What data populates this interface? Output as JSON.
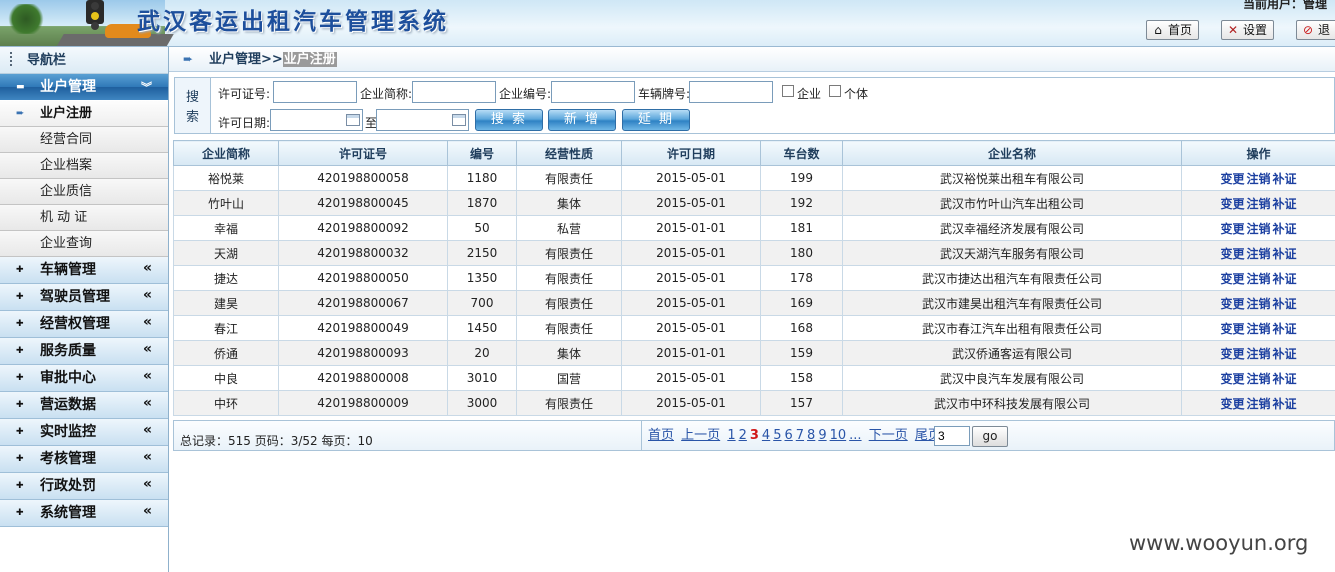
{
  "header": {
    "title": "武汉客运出租汽车管理系统",
    "current_user": "当前用户：管理",
    "buttons": [
      {
        "label": "首页",
        "icon": "home-icon"
      },
      {
        "label": "设置",
        "icon": "tools-icon"
      },
      {
        "label": "退",
        "icon": "stop-icon"
      }
    ]
  },
  "sidebar": {
    "title": "导航栏",
    "active_group": {
      "label": "业户管理",
      "items": [
        {
          "label": "业户注册",
          "active": true
        },
        {
          "label": "经营合同"
        },
        {
          "label": "企业档案"
        },
        {
          "label": "企业质信"
        },
        {
          "label": "机 动 证"
        },
        {
          "label": "企业查询"
        }
      ]
    },
    "groups": [
      "车辆管理",
      "驾驶员管理",
      "经营权管理",
      "服务质量",
      "审批中心",
      "营运数据",
      "实时监控",
      "考核管理",
      "行政处罚",
      "系统管理"
    ]
  },
  "breadcrumb": {
    "parent": "业户管理>>",
    "current": "业户注册"
  },
  "search": {
    "label": "搜索",
    "fields": {
      "license_no": "许可证号:",
      "company_abbr": "企业简称:",
      "company_no": "企业编号:",
      "plate_no": "车辆牌号:",
      "enterprise": "企业",
      "individual": "个体",
      "license_date": "许可日期:",
      "to": "至"
    },
    "buttons": {
      "search": "搜 索",
      "add": "新 增",
      "extend": "延 期"
    }
  },
  "table": {
    "columns": [
      "企业简称",
      "许可证号",
      "编号",
      "经营性质",
      "许可日期",
      "车台数",
      "企业名称",
      "操作"
    ],
    "actions": [
      "变更",
      "注销",
      "补证"
    ],
    "rows": [
      [
        "裕悦莱",
        "420198800058",
        "1180",
        "有限责任",
        "2015-05-01",
        "199",
        "武汉裕悦莱出租车有限公司"
      ],
      [
        "竹叶山",
        "420198800045",
        "1870",
        "集体",
        "2015-05-01",
        "192",
        "武汉市竹叶山汽车出租公司"
      ],
      [
        "幸福",
        "420198800092",
        "50",
        "私营",
        "2015-01-01",
        "181",
        "武汉幸福经济发展有限公司"
      ],
      [
        "天湖",
        "420198800032",
        "2150",
        "有限责任",
        "2015-05-01",
        "180",
        "武汉天湖汽车服务有限公司"
      ],
      [
        "捷达",
        "420198800050",
        "1350",
        "有限责任",
        "2015-05-01",
        "178",
        "武汉市捷达出租汽车有限责任公司"
      ],
      [
        "建昊",
        "420198800067",
        "700",
        "有限责任",
        "2015-05-01",
        "169",
        "武汉市建昊出租汽车有限责任公司"
      ],
      [
        "春江",
        "420198800049",
        "1450",
        "有限责任",
        "2015-05-01",
        "168",
        "武汉市春江汽车出租有限责任公司"
      ],
      [
        "侨通",
        "420198800093",
        "20",
        "集体",
        "2015-01-01",
        "159",
        "武汉侨通客运有限公司"
      ],
      [
        "中良",
        "420198800008",
        "3010",
        "国营",
        "2015-05-01",
        "158",
        "武汉中良汽车发展有限公司"
      ],
      [
        "中环",
        "420198800009",
        "3000",
        "有限责任",
        "2015-05-01",
        "157",
        "武汉市中环科技发展有限公司"
      ]
    ]
  },
  "pagination": {
    "summary": "总记录：515 页码：3/52 每页：10",
    "first": "首页",
    "prev": "上一页",
    "pages": [
      "1",
      "2",
      "3",
      "4",
      "5",
      "6",
      "7",
      "8",
      "9",
      "10",
      "..."
    ],
    "current_page": "3",
    "next": "下一页",
    "last": "尾页",
    "input_value": "3",
    "go": "go"
  },
  "watermark": "www.wooyun.org",
  "colors": {
    "accent": "#2f78b8",
    "link": "#1b3fa0",
    "current_page": "#d01818"
  }
}
